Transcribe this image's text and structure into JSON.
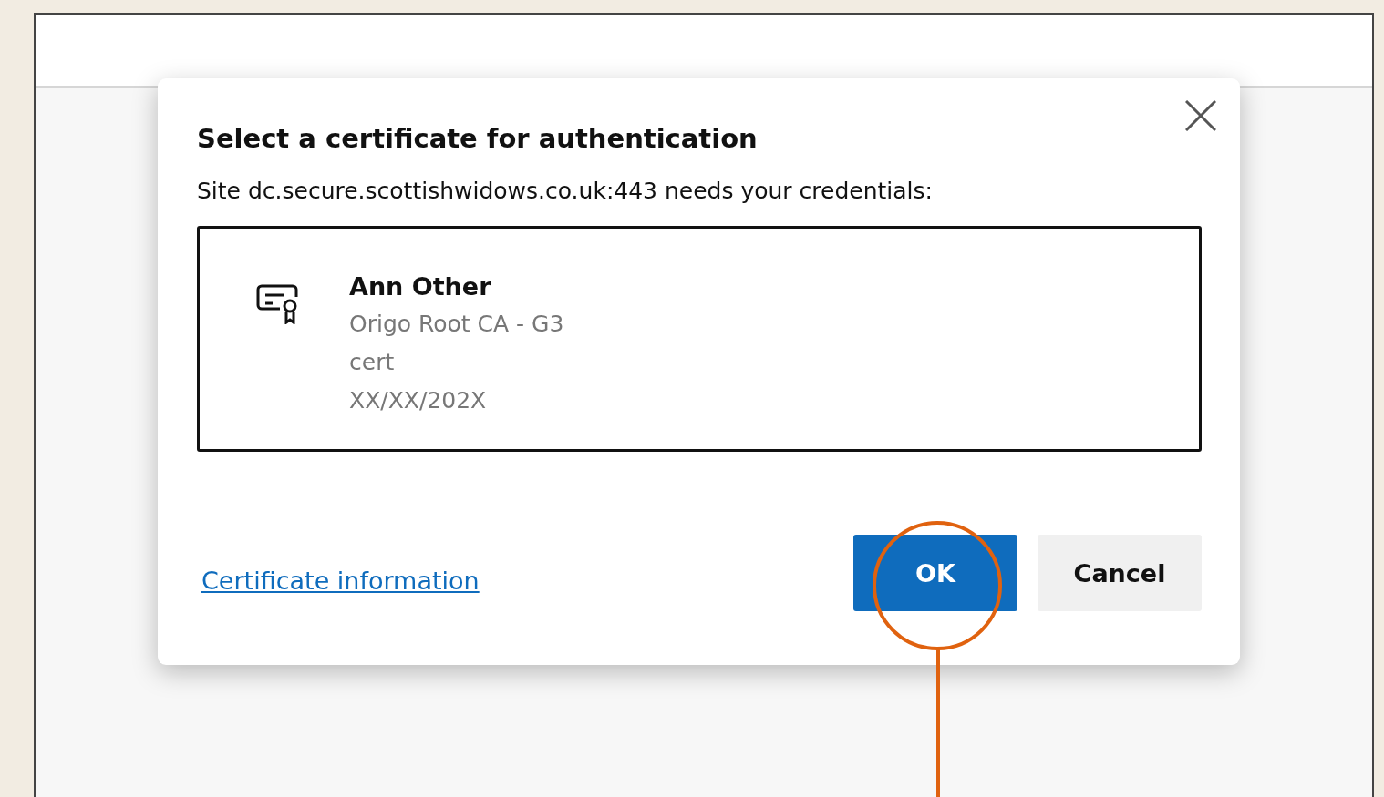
{
  "dialog": {
    "title": "Select a certificate for authentication",
    "message": "Site dc.secure.scottishwidows.co.uk:443 needs your credentials:",
    "certificates": [
      {
        "name": "Ann Other",
        "issuer": "Origo Root CA - G3",
        "type": "cert",
        "date": "XX/XX/202X",
        "selected": true
      }
    ],
    "link": "Certificate information",
    "buttons": [
      {
        "label": "OK",
        "kind": "primary"
      },
      {
        "label": "Cancel",
        "kind": "secondary"
      }
    ]
  }
}
